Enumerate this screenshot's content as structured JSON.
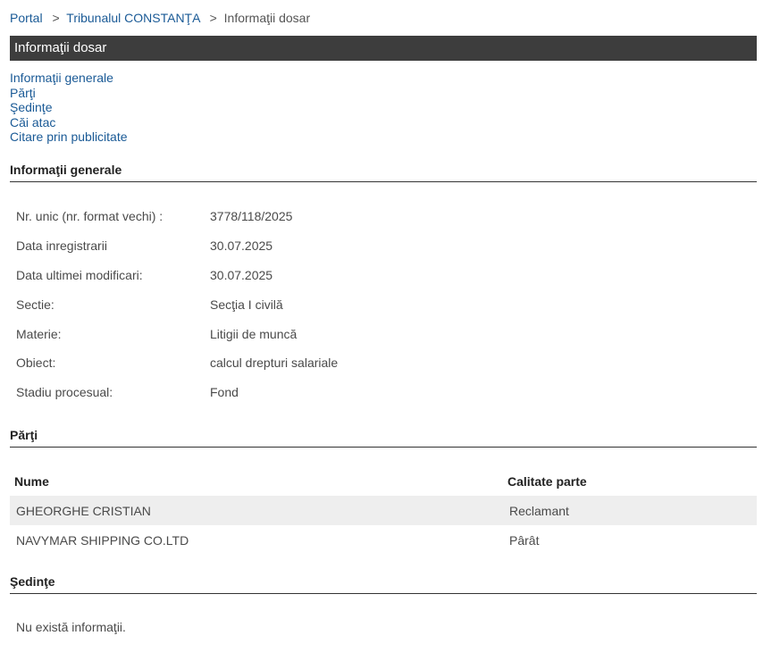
{
  "breadcrumb": {
    "portal": "Portal",
    "sep": ">",
    "court": "Tribunalul CONSTANŢA",
    "current": "Informaţii dosar"
  },
  "page_title": "Informaţii dosar",
  "nav": {
    "items": [
      "Informaţii generale",
      "Părţi",
      "Şedinţe",
      "Căi atac",
      "Citare prin publicitate"
    ]
  },
  "general": {
    "heading": "Informaţii generale",
    "rows": [
      {
        "label": "Nr. unic (nr. format vechi) :",
        "value": "3778/118/2025"
      },
      {
        "label": "Data inregistrarii",
        "value": "30.07.2025"
      },
      {
        "label": "Data ultimei modificari:",
        "value": "30.07.2025"
      },
      {
        "label": "Sectie:",
        "value": "Secţia I civilă"
      },
      {
        "label": "Materie:",
        "value": "Litigii de muncă"
      },
      {
        "label": "Obiect:",
        "value": "calcul drepturi salariale"
      },
      {
        "label": "Stadiu procesual:",
        "value": "Fond"
      }
    ]
  },
  "parti": {
    "heading": "Părţi",
    "columns": [
      "Nume",
      "Calitate parte"
    ],
    "rows": [
      [
        "GHEORGHE CRISTIAN",
        "Reclamant"
      ],
      [
        "NAVYMAR SHIPPING CO.LTD",
        "Pârât"
      ]
    ]
  },
  "sedinte": {
    "heading": "Şedinţe",
    "empty": "Nu există informaţii."
  }
}
